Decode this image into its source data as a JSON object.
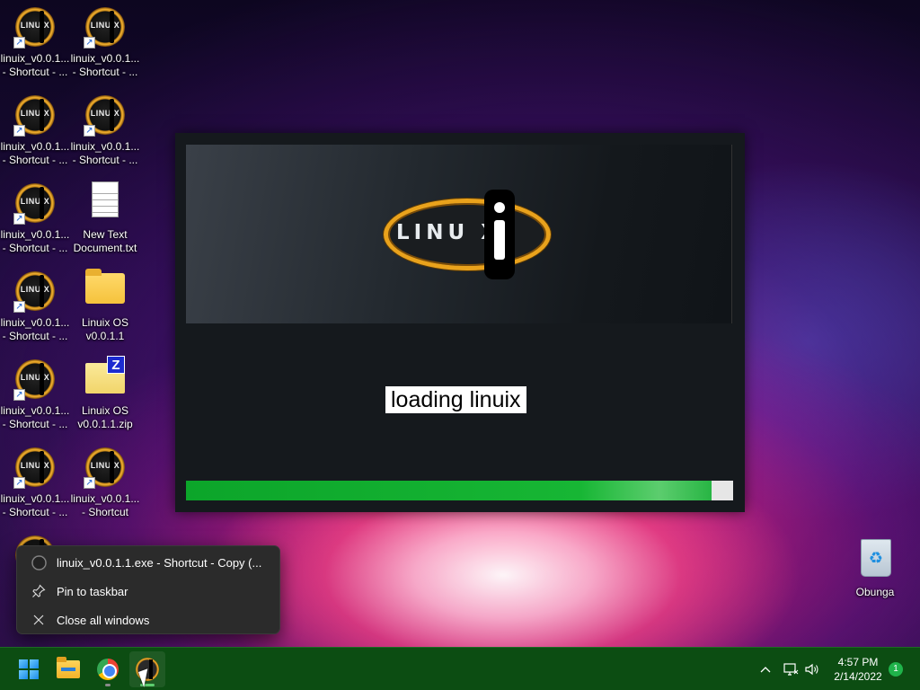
{
  "desktop": {
    "icons": [
      {
        "label": "linuix_v0.0.1...\n- Shortcut - ..."
      },
      {
        "label": "linuix_v0.0.1...\n- Shortcut - ..."
      },
      {
        "label": "linuix_v0.0.1...\n- Shortcut - ..."
      },
      {
        "label": "linuix_v0.0.1...\n- Shortcut - ..."
      },
      {
        "label": "linuix_v0.0.1...\n- Shortcut - ..."
      },
      {
        "label": "New Text\nDocument.txt"
      },
      {
        "label": "linuix_v0.0.1...\n- Shortcut - ..."
      },
      {
        "label": "Linuix OS\nv0.0.1.1"
      },
      {
        "label": "linuix_v0.0.1...\n- Shortcut - ..."
      },
      {
        "label": "Linuix OS\nv0.0.1.1.zip"
      },
      {
        "label": "linuix_v0.0.1...\n- Shortcut - ..."
      },
      {
        "label": "linuix_v0.0.1...\n- Shortcut"
      },
      {
        "label": "Obunga"
      }
    ],
    "logo_text": "LINUIX"
  },
  "loader": {
    "logo_text": "LINU  X",
    "status_text": "loading linuix",
    "progress_fraction": 0.96
  },
  "jump_list": {
    "items": [
      {
        "label": "linuix_v0.0.1.1.exe - Shortcut - Copy (...",
        "icon": "linuix-app-icon"
      },
      {
        "label": "Pin to taskbar",
        "icon": "pin-icon"
      },
      {
        "label": "Close all windows",
        "icon": "close-icon"
      }
    ]
  },
  "taskbar": {
    "apps": [
      "start",
      "file-explorer",
      "chrome",
      "linuix"
    ],
    "tray_icons": [
      "chevron-up-icon",
      "network-icon",
      "volume-icon"
    ],
    "time": "4:57 PM",
    "date": "2/14/2022",
    "notification_count": "1"
  },
  "colors": {
    "taskbar": "#0c4d12",
    "progress": "#17b634",
    "logo_ring": "#e9a21c"
  }
}
